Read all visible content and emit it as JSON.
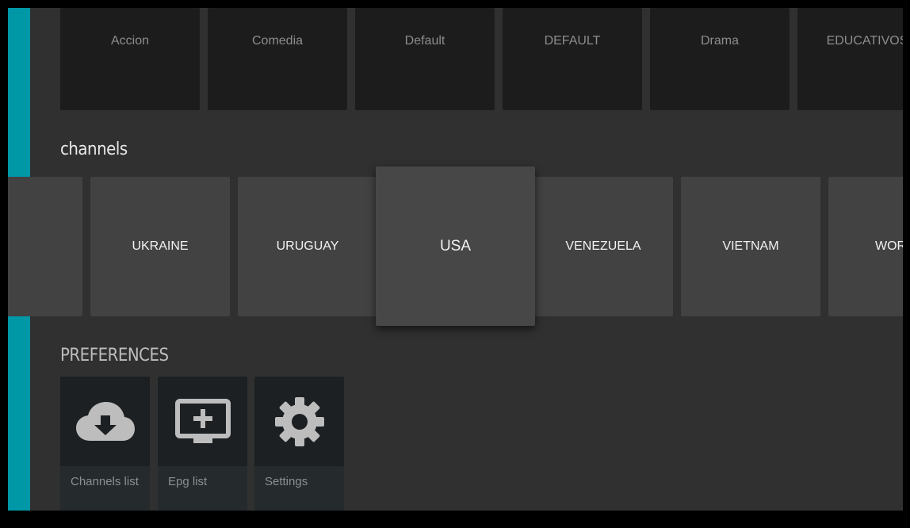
{
  "genres": [
    "Accion",
    "Comedia",
    "Default",
    "DEFAULT",
    "Drama",
    "EDUCATIVOS"
  ],
  "channels_section": {
    "title": "channels"
  },
  "channels": [
    "",
    "UKRAINE",
    "URUGUAY",
    "USA",
    "VENEZUELA",
    "VIETNAM",
    "WOR"
  ],
  "focused_channel": "USA",
  "preferences_section": {
    "title": "PREFERENCES",
    "items": [
      {
        "label": "Channels list",
        "icon": "cloud-download-icon"
      },
      {
        "label": "Epg list",
        "icon": "tv-add-icon"
      },
      {
        "label": "Settings",
        "icon": "gear-icon"
      }
    ]
  },
  "colors": {
    "accent": "#0097a7",
    "background": "#303030",
    "tile": "#424242",
    "genre_tile": "#1c1c1c",
    "icon": "#bdbdbd"
  }
}
